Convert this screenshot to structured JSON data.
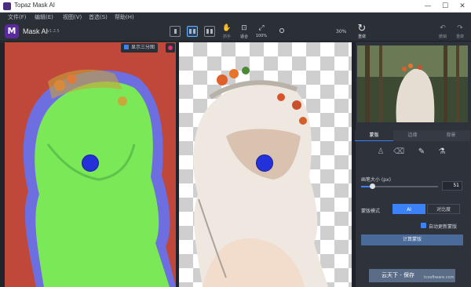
{
  "window": {
    "title": "Topaz Mask AI",
    "controls": [
      "—",
      "☐",
      "✕"
    ]
  },
  "menu": [
    "文件(F)",
    "编辑(E)",
    "视图(V)",
    "首选(S)",
    "帮助(H)"
  ],
  "toolbar": {
    "app_name": "Mask AI",
    "version": "v1.2.5",
    "tool_labels": [
      "抓手",
      "适合",
      "100%"
    ],
    "zoom": "30%",
    "redo_label": "重做",
    "undo_label": "撤销",
    "reset_label": "重做"
  },
  "canvas": {
    "overlay_label": "显示三分图"
  },
  "panel": {
    "tabs": [
      "蒙版",
      "边缘",
      "背景"
    ],
    "brush_size_label": "画笔大小 (px)",
    "brush_size_value": "51",
    "mask_mode_label": "蒙版模式",
    "mode_options": [
      "AI",
      "对比度"
    ],
    "auto_update_label": "自动更新蒙版",
    "compute_button": "计算蒙版",
    "save_button": "云天下 - 保存"
  },
  "watermark": "tcsoftware.com",
  "colors": {
    "accent": "#3b82f6",
    "fg_mask": "#7be858",
    "bg_mask": "#c0483a",
    "edge_mask": "#6d6fe0"
  }
}
